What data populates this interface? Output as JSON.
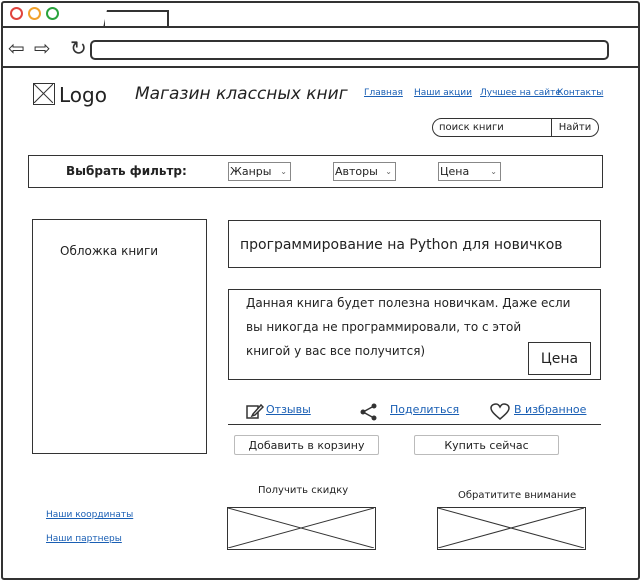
{
  "header": {
    "logo_text": "Logo",
    "site_title": "Магазин классных книг",
    "nav": [
      "Главная",
      "Наши акции",
      "Лучшее на сайте",
      "Контакты"
    ]
  },
  "search": {
    "placeholder": "поиск книги",
    "button": "Найти"
  },
  "filters": {
    "label": "Выбрать фильтр:",
    "genre": "Жанры",
    "author": "Авторы",
    "price": "Цена"
  },
  "book": {
    "cover_label": "Обложка книги",
    "title": "программирование на Python для новичков",
    "description_lines": [
      "Данная книга будет полезна новичкам. Даже если",
      "вы никогда не программировали, то с этой",
      "книгой у вас все получится)"
    ],
    "price_button": "Цена"
  },
  "actions": {
    "reviews": "Отзывы",
    "share": "Поделиться",
    "favorites": "В избранное"
  },
  "buttons": {
    "add_to_cart": "Добавить в корзину",
    "buy_now": "Купить сейчас"
  },
  "footer": {
    "links": [
      "Наши координаты",
      "Наши партнеры"
    ],
    "promo_discount": "Получить скидку",
    "promo_attention": "Обратитите внимание"
  },
  "colors": {
    "link": "#1a5fb4",
    "dot_close": "#e0443e",
    "dot_minimize": "#f1a12c",
    "dot_maximize": "#2aa33d"
  }
}
